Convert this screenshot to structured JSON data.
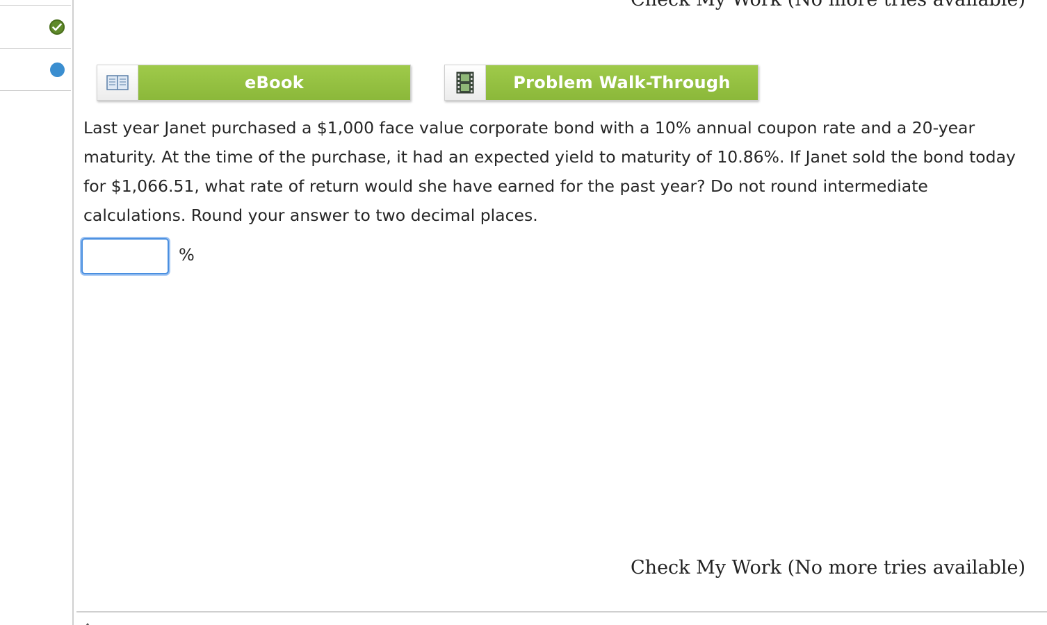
{
  "top_link": {
    "label": "Check My Work (No more tries available)"
  },
  "sidebar": {
    "items": [
      {
        "status": "completed",
        "icon": "check-circle-icon",
        "color": "#5f8a2a"
      },
      {
        "status": "current",
        "icon": "blue-dot-icon",
        "color": "#3b8ed0"
      }
    ]
  },
  "resources": {
    "ebook_label": "eBook",
    "walkthrough_label": "Problem Walk-Through",
    "accent_color": "#95c142"
  },
  "question": {
    "text": "Last year Janet purchased a $1,000 face value corporate bond with a 10% annual coupon rate and a 20-year maturity. At the time of the purchase, it had an expected yield to maturity of 10.86%. If Janet sold the bond today for $1,066.51, what rate of return would she have earned for the past year? Do not round intermediate calculations. Round your answer to two decimal places."
  },
  "answer": {
    "value": "",
    "unit": "%"
  },
  "bottom_link": {
    "label": "Check My Work (No more tries available)"
  }
}
